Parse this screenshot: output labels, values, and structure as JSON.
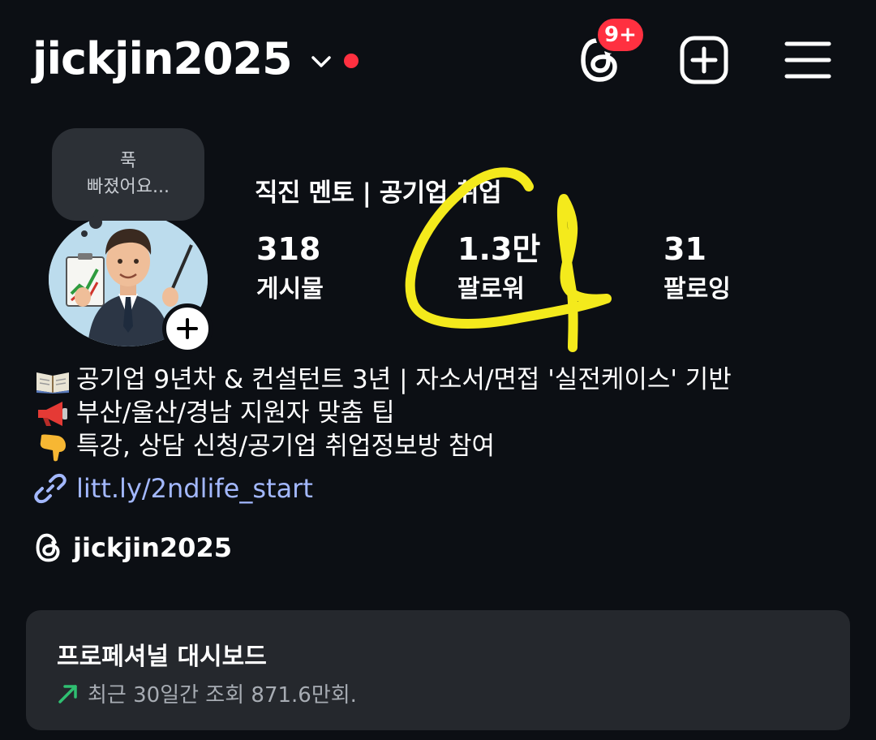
{
  "header": {
    "username": "jickjin2025",
    "notification_badge": "9+",
    "icons": {
      "account_switch": "chevron-down-icon",
      "threads": "threads-icon",
      "create": "plus-square-icon",
      "menu": "hamburger-menu-icon"
    }
  },
  "profile": {
    "note_line1": "푹",
    "note_line2": "빠졌어요...",
    "display_name": "직진 멘토 | 공기업 취업",
    "stats": [
      {
        "value": "318",
        "label": "게시물"
      },
      {
        "value": "1.3만",
        "label": "팔로워"
      },
      {
        "value": "31",
        "label": "팔로잉"
      }
    ]
  },
  "bio": {
    "lines": [
      {
        "icon": "book-icon",
        "text": "공기업 9년차 & 컨설턴트 3년 | 자소서/면접 '실전케이스' 기반"
      },
      {
        "icon": "megaphone-icon",
        "text": "부산/울산/경남 지원자 맞춤 팁"
      },
      {
        "icon": "pointing-down-hand-icon",
        "text": "특강, 상담 신청/공기업 취업정보방 참여"
      }
    ],
    "link": "litt.ly/2ndlife_start",
    "threads_handle": "jickjin2025"
  },
  "dashboard": {
    "title": "프로페셔널 대시보드",
    "subtitle": "최근 30일간 조회 871.6만회."
  },
  "colors": {
    "background": "#0c0f14",
    "badge": "#ff3040",
    "link": "#a3b8ff",
    "card": "#25282d",
    "trend_up": "#2fbf71",
    "annotation": "#f4ea1c"
  }
}
